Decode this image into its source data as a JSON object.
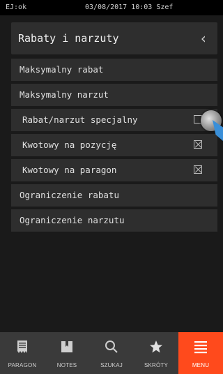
{
  "status": {
    "left": "EJ:ok",
    "middle": "03/08/2017 10:03 Szef"
  },
  "header": {
    "title": "Rabaty i narzuty",
    "back_icon": "chevron-left-icon"
  },
  "rows": [
    {
      "label": "Maksymalny rabat"
    },
    {
      "label": "Maksymalny narzut"
    },
    {
      "label": "Rabat/narzut specjalny",
      "checked": false
    },
    {
      "label": "Kwotowy na pozycję",
      "checked": true
    },
    {
      "label": "Kwotowy na paragon",
      "checked": true
    },
    {
      "label": "Ograniczenie rabatu"
    },
    {
      "label": "Ograniczenie narzutu"
    }
  ],
  "nav": [
    {
      "label": "PARAGON",
      "icon": "receipt-icon"
    },
    {
      "label": "NOTES",
      "icon": "notebook-icon"
    },
    {
      "label": "SZUKAJ",
      "icon": "search-icon"
    },
    {
      "label": "SKRÓTY",
      "icon": "star-icon"
    },
    {
      "label": "MENU",
      "icon": "menu-icon",
      "active": true
    }
  ],
  "colors": {
    "accent": "#ff4a1c",
    "row_bg": "#2e2e2e",
    "background": "#1a1a1a"
  }
}
